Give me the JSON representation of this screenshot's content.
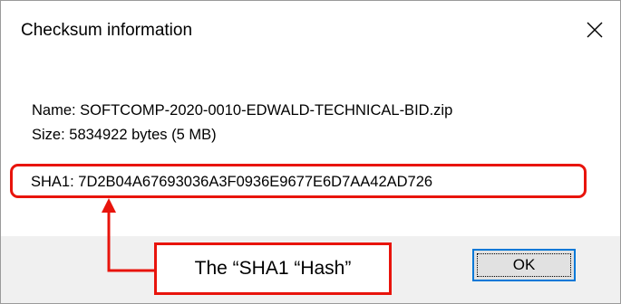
{
  "dialog": {
    "title": "Checksum information",
    "close_icon": "close-icon"
  },
  "info": {
    "name_line": "Name: SOFTCOMP-2020-0010-EDWALD-TECHNICAL-BID.zip",
    "size_line": "Size: 5834922 bytes (5 MB)",
    "sha1_line": "SHA1: 7D2B04A67693036A3F0936E9677E6D7AA42AD726"
  },
  "buttons": {
    "ok_label": "OK"
  },
  "annotation": {
    "callout_text": "The “SHA1 “Hash”",
    "color": "#e8140c"
  },
  "colors": {
    "footer_bg": "#f0f0f0",
    "ok_button_border": "#0078d7"
  }
}
